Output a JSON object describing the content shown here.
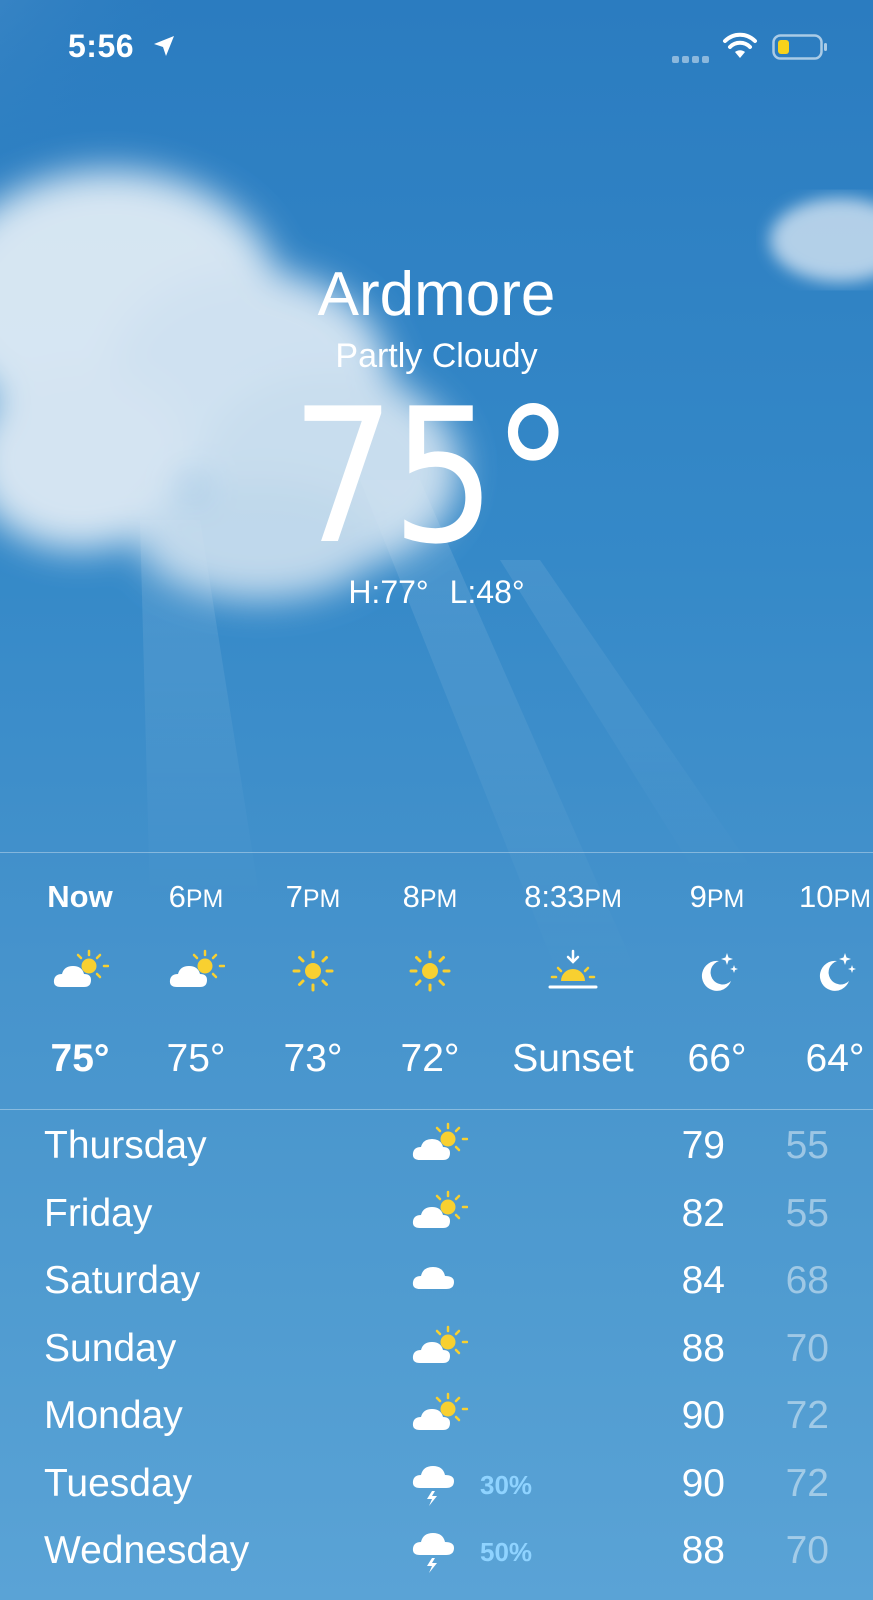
{
  "status_bar": {
    "time": "5:56",
    "icons": [
      "location-arrow-icon",
      "cellular-signal-icon",
      "wifi-icon",
      "battery-low-icon"
    ],
    "battery_color": "#f7d21b"
  },
  "location": {
    "city": "Ardmore",
    "condition": "Partly Cloudy",
    "temperature": "75°",
    "high_low": "H:77°  L:48°"
  },
  "hourly": [
    {
      "label": "Now",
      "label_bold": true,
      "suffix": "",
      "icon": "partly-cloudy-day-icon",
      "temp": "75°"
    },
    {
      "label": "6",
      "suffix": "PM",
      "icon": "partly-cloudy-day-icon",
      "temp": "75°"
    },
    {
      "label": "7",
      "suffix": "PM",
      "icon": "sun-icon",
      "temp": "73°"
    },
    {
      "label": "8",
      "suffix": "PM",
      "icon": "sun-icon",
      "temp": "72°"
    },
    {
      "label": "8:33",
      "suffix": "PM",
      "icon": "sunset-icon",
      "temp": "Sunset"
    },
    {
      "label": "9",
      "suffix": "PM",
      "icon": "moon-stars-icon",
      "temp": "66°"
    },
    {
      "label": "10",
      "suffix": "PM",
      "icon": "moon-stars-icon",
      "temp": "64°"
    }
  ],
  "daily": [
    {
      "day": "Thursday",
      "icon": "partly-cloudy-day-icon",
      "pop": "",
      "high": "79",
      "low": "55"
    },
    {
      "day": "Friday",
      "icon": "partly-cloudy-day-icon",
      "pop": "",
      "high": "82",
      "low": "55"
    },
    {
      "day": "Saturday",
      "icon": "cloud-icon",
      "pop": "",
      "high": "84",
      "low": "68"
    },
    {
      "day": "Sunday",
      "icon": "partly-cloudy-day-icon",
      "pop": "",
      "high": "88",
      "low": "70"
    },
    {
      "day": "Monday",
      "icon": "partly-cloudy-day-icon",
      "pop": "",
      "high": "90",
      "low": "72"
    },
    {
      "day": "Tuesday",
      "icon": "thunderstorm-icon",
      "pop": "30%",
      "high": "90",
      "low": "72"
    },
    {
      "day": "Wednesday",
      "icon": "thunderstorm-icon",
      "pop": "50%",
      "high": "88",
      "low": "70"
    }
  ]
}
